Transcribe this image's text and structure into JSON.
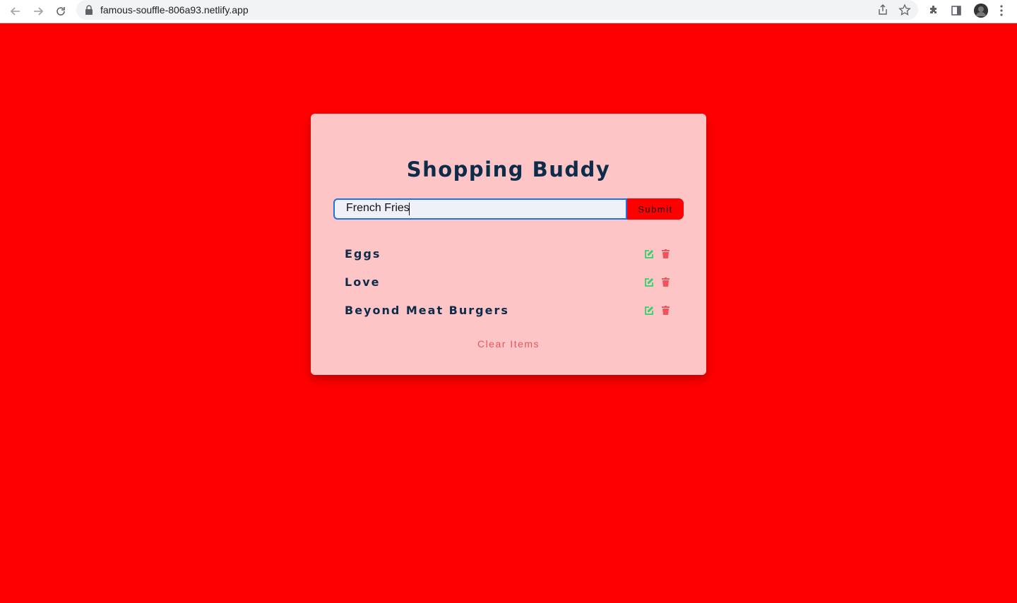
{
  "browser": {
    "url": "famous-souffle-806a93.netlify.app"
  },
  "app": {
    "title": "Shopping Buddy",
    "input_value": "French Fries",
    "submit_label": "Submit",
    "items": [
      {
        "label": "Eggs"
      },
      {
        "label": "Love"
      },
      {
        "label": "Beyond Meat Burgers"
      }
    ],
    "clear_label": "Clear Items"
  },
  "colors": {
    "page_background": "#ff0000",
    "card_background": "#fdc5c5",
    "title_color": "#0d2c4a",
    "edit_icon": "#2bd46a",
    "delete_icon": "#f1525c",
    "clear_text": "#e8545e"
  }
}
